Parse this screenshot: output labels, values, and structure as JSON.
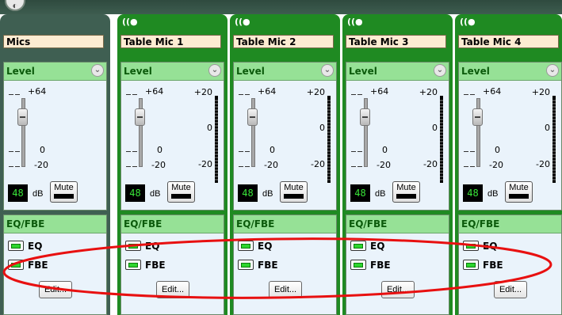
{
  "strip": {
    "level_header": "Level",
    "eq_header": "EQ/FBE",
    "scale": {
      "top": "+64",
      "zero": "0",
      "bottom": "-20"
    },
    "meter": {
      "top": "+20",
      "mid": "0",
      "bottom": "-20"
    },
    "db_unit": "dB",
    "mute_label": "Mute",
    "eq_label": "EQ",
    "fbe_label": "FBE",
    "edit_label": "Edit..."
  },
  "channels": [
    {
      "name": "Mics",
      "level": "48",
      "has_meter": false,
      "has_icon": false
    },
    {
      "name": "Table Mic 1",
      "level": "48",
      "has_meter": true,
      "has_icon": true
    },
    {
      "name": "Table Mic 2",
      "level": "48",
      "has_meter": true,
      "has_icon": true
    },
    {
      "name": "Table Mic 3",
      "level": "48",
      "has_meter": true,
      "has_icon": true
    },
    {
      "name": "Table Mic 4",
      "level": "48",
      "has_meter": true,
      "has_icon": true
    }
  ],
  "icons": {
    "broadcast": "wireless-icon",
    "collapse": "chevron-down-icon"
  },
  "colors": {
    "channel": "#1f8a22",
    "group": "#3f5f52",
    "header": "#96e196",
    "annotation": "#e81010"
  }
}
